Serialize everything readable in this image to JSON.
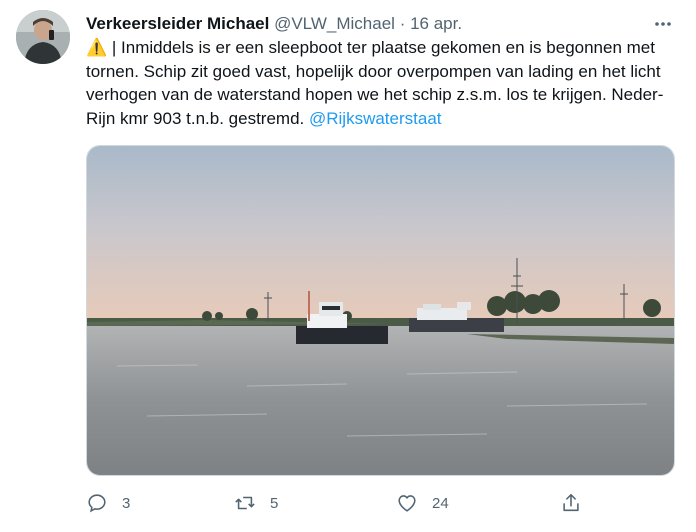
{
  "author": {
    "name": "Verkeersleider Michael",
    "handle": "@VLW_Michael",
    "separator": "·",
    "date": "16 apr."
  },
  "tweet": {
    "emoji": "⚠️",
    "body": " | Inmiddels is er een sleepboot ter plaatse gekomen en is begonnen met tornen. Schip zit goed vast, hopelijk door overpompen van lading en het licht verhogen van de waterstand hopen we het schip z.s.m. los te krijgen. Neder-Rijn kmr 903 t.n.b. gestremd. ",
    "mention": "@Rijkswaterstaat"
  },
  "actions": {
    "replies": "3",
    "retweets": "5",
    "likes": "24"
  },
  "icons": [
    "more-icon",
    "reply-icon",
    "retweet-icon",
    "like-icon",
    "share-icon"
  ],
  "colors": {
    "accent": "#1d9bf0",
    "muted": "#536471",
    "text": "#0f1419"
  }
}
